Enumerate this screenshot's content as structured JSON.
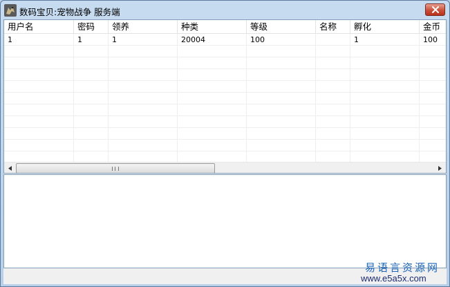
{
  "window": {
    "title": "数码宝贝:宠物战争 服务端",
    "icon": "dragon-app-icon",
    "close_icon": "close-icon"
  },
  "table": {
    "columns": [
      "用户名",
      "密码",
      "领养",
      "种类",
      "等级",
      "名称",
      "孵化",
      "金币"
    ],
    "rows": [
      [
        "1",
        "1",
        "1",
        "20004",
        "100",
        "",
        "1",
        "100"
      ]
    ]
  },
  "scrollbar": {
    "left_icon": "scroll-left-icon",
    "right_icon": "scroll-right-icon",
    "thumb_position": 0
  },
  "log": {
    "text": ""
  },
  "watermark": {
    "cn": "易语言资源网",
    "en": "www.e5a5x.com"
  },
  "colors": {
    "titlebar": "#bcd3ea",
    "close_button": "#c9503a",
    "grid_border": "#7f9db9",
    "watermark_cn": "#1b64b8",
    "watermark_en": "#1b2c70"
  }
}
